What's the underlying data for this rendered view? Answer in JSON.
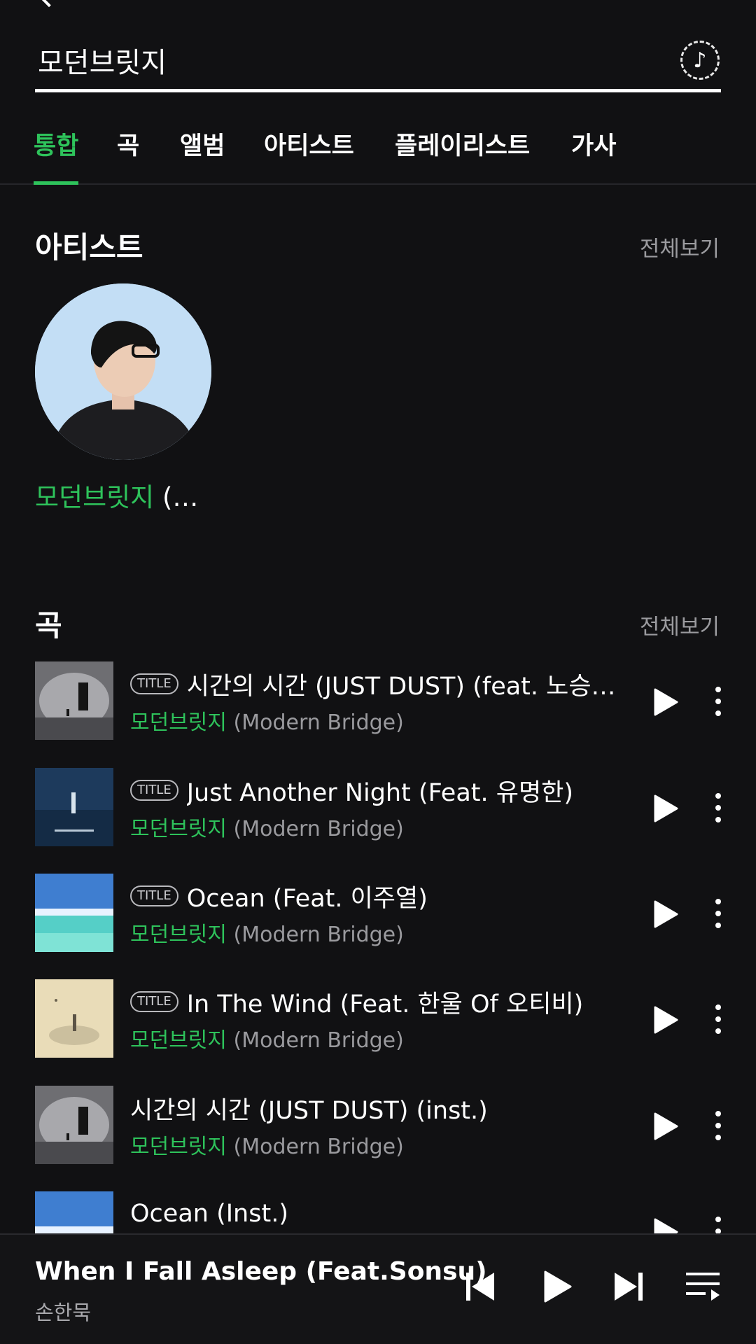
{
  "search": {
    "query": "모던브릿지",
    "music_search_icon": "music-note-icon"
  },
  "tabs": [
    {
      "label": "통합",
      "active": true
    },
    {
      "label": "곡"
    },
    {
      "label": "앨범"
    },
    {
      "label": "아티스트"
    },
    {
      "label": "플레이리스트"
    },
    {
      "label": "가사"
    }
  ],
  "artist_section": {
    "title": "아티스트",
    "see_all": "전체보기",
    "artist": {
      "name_highlight": "모던브릿지",
      "name_rest": " (…"
    }
  },
  "song_section": {
    "title": "곡",
    "see_all": "전체보기",
    "songs": [
      {
        "badge": "TITLE",
        "title": "시간의 시간 (JUST DUST) (feat. 노승…",
        "artist_highlight": "모던브릿지",
        "artist_rest": " (Modern Bridge)"
      },
      {
        "badge": "TITLE",
        "title": "Just Another Night (Feat. 유명한)",
        "artist_highlight": "모던브릿지",
        "artist_rest": " (Modern Bridge)"
      },
      {
        "badge": "TITLE",
        "title": "Ocean (Feat. 이주열)",
        "artist_highlight": "모던브릿지",
        "artist_rest": " (Modern Bridge)"
      },
      {
        "badge": "TITLE",
        "title": "In The Wind (Feat. 한울 Of 오티비)",
        "artist_highlight": "모던브릿지",
        "artist_rest": " (Modern Bridge)"
      },
      {
        "badge": "",
        "title": "시간의 시간 (JUST DUST) (inst.)",
        "artist_highlight": "모던브릿지",
        "artist_rest": " (Modern Bridge)"
      },
      {
        "badge": "",
        "title": "Ocean (Inst.)",
        "artist_highlight": "",
        "artist_rest": ""
      }
    ]
  },
  "mini_player": {
    "title": "When I Fall Asleep (Feat.Sonsu)",
    "artist": "손한묵"
  },
  "colors": {
    "accent": "#2ec35b",
    "background": "#111113",
    "muted": "#9a9a9e"
  }
}
